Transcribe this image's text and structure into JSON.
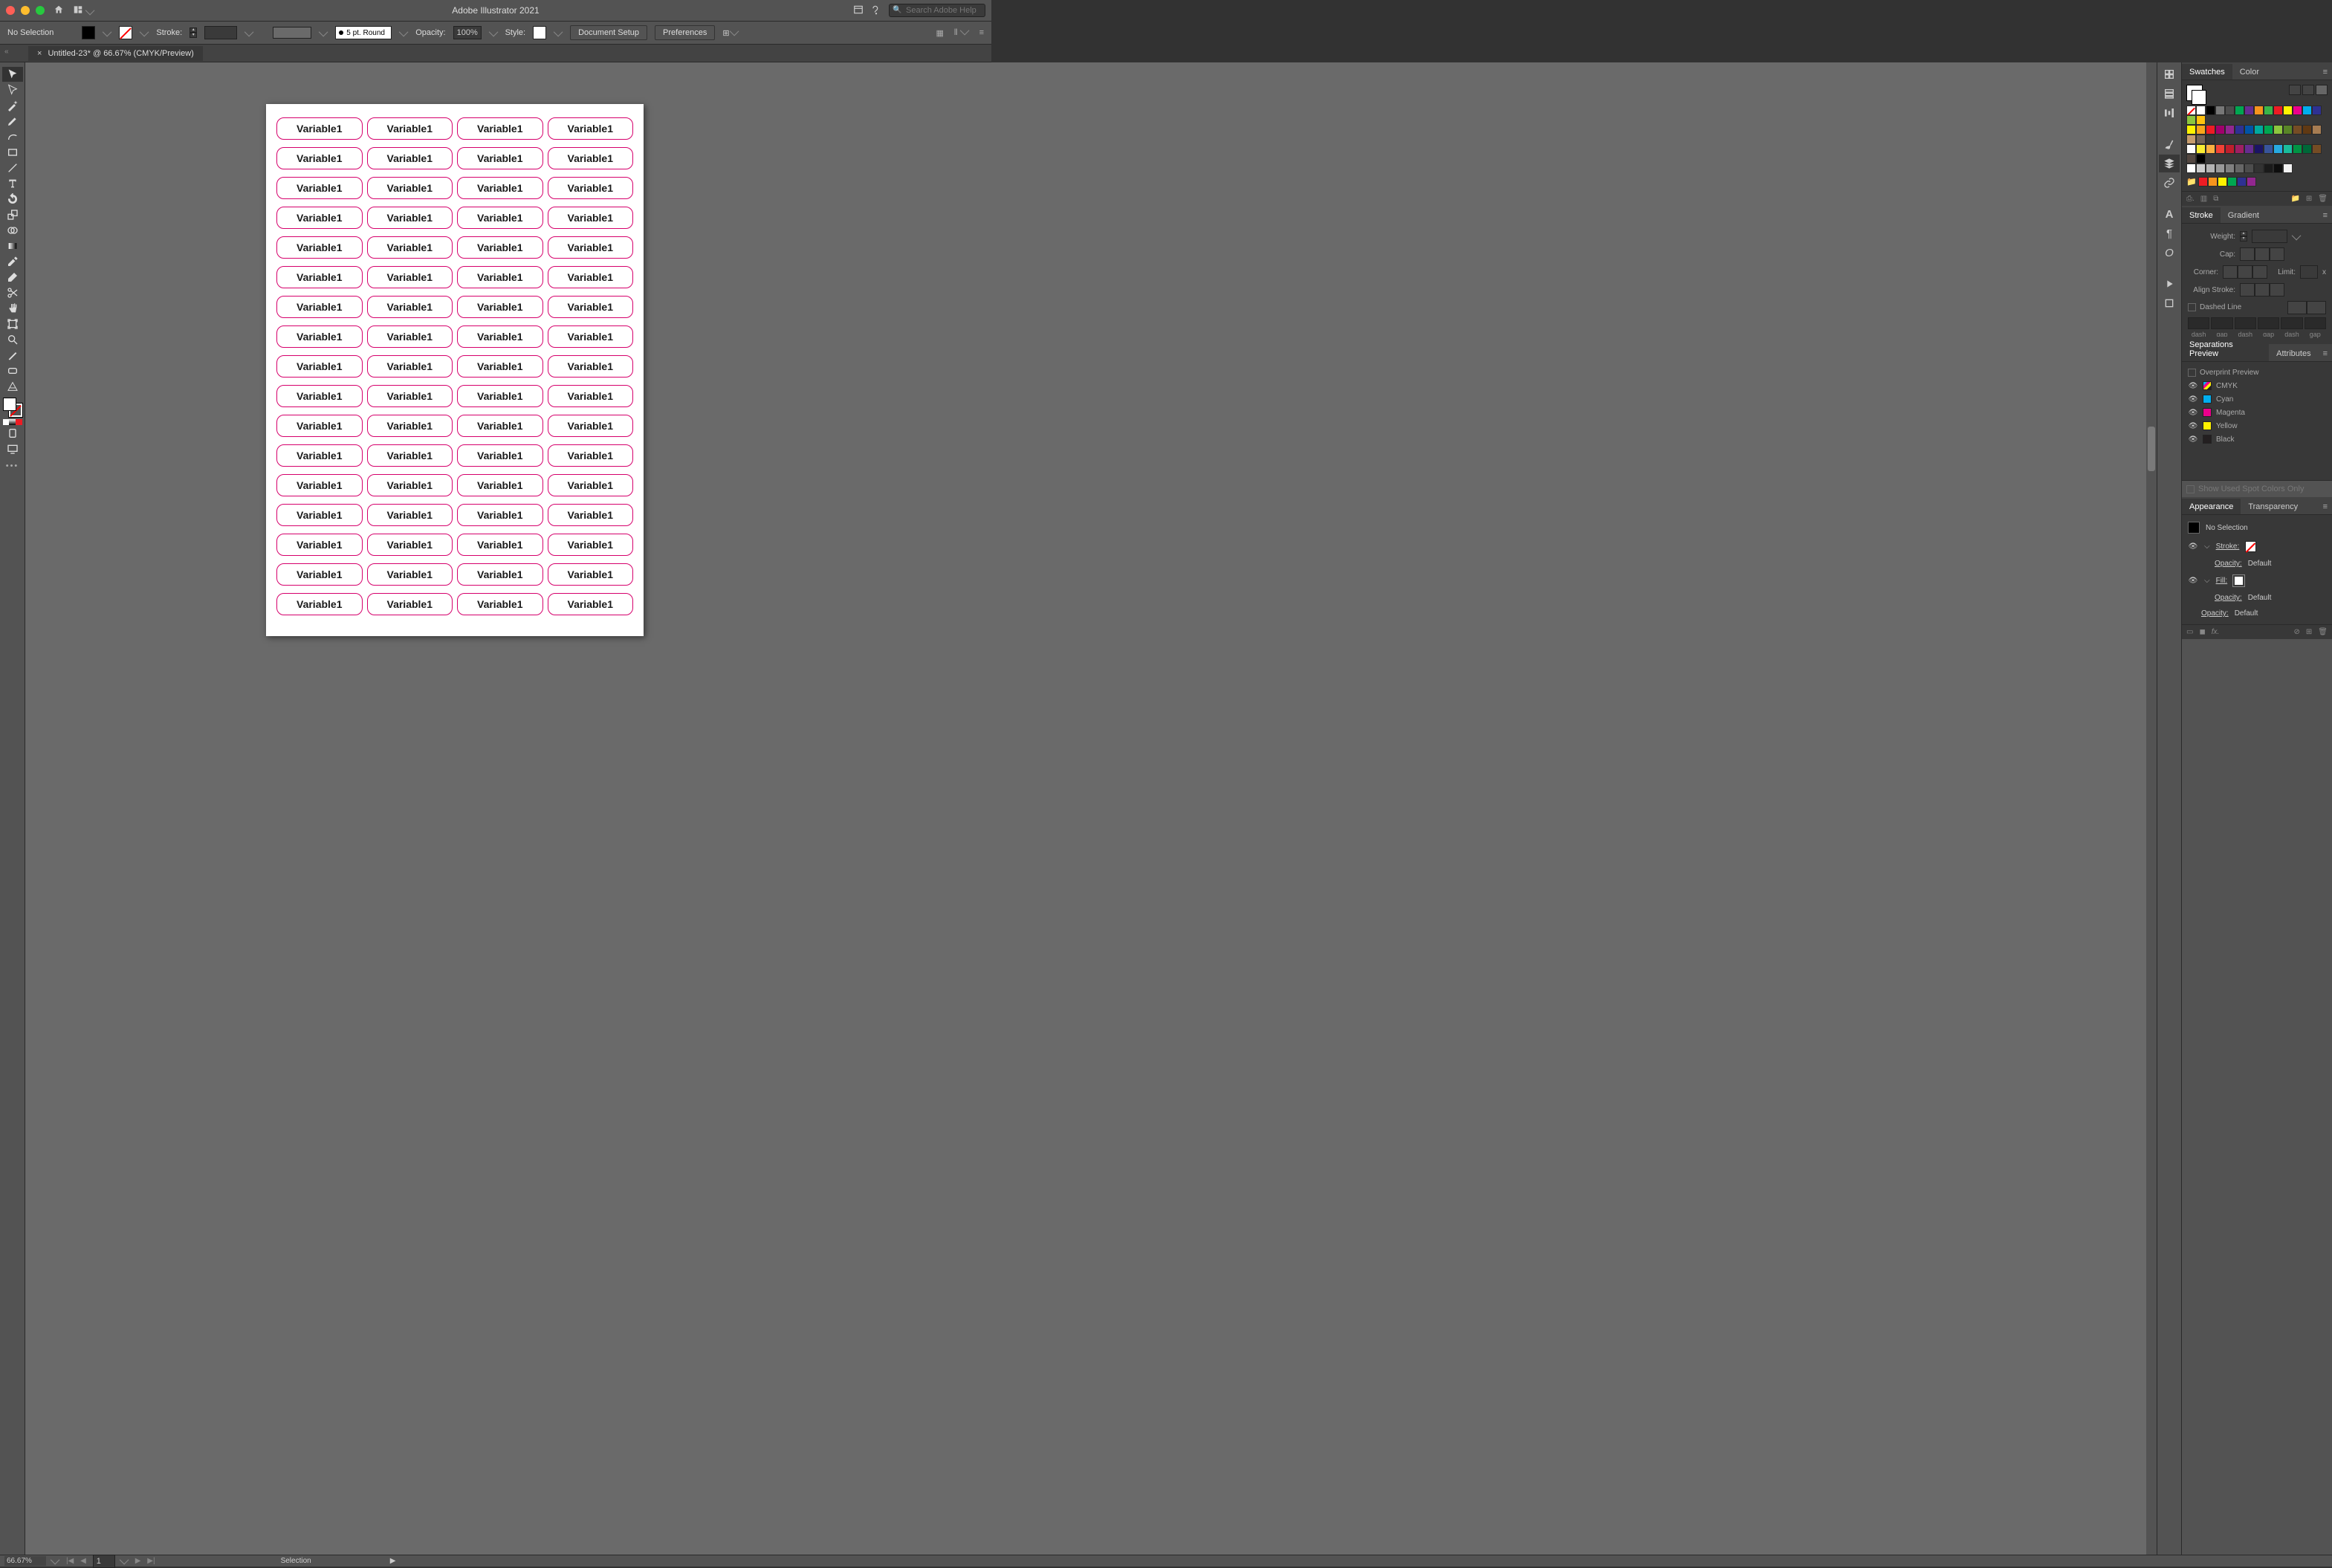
{
  "titlebar": {
    "app_title": "Adobe Illustrator 2021",
    "search_placeholder": "Search Adobe Help"
  },
  "controlbar": {
    "selection_label": "No Selection",
    "stroke_label": "Stroke:",
    "brush_label": "5 pt. Round",
    "opacity_label": "Opacity:",
    "opacity_value": "100%",
    "style_label": "Style:",
    "btn_doc_setup": "Document Setup",
    "btn_prefs": "Preferences"
  },
  "doc_tab": {
    "title": "Untitled-23* @ 66.67% (CMYK/Preview)"
  },
  "artboard": {
    "rows": 17,
    "cols": 4,
    "cell_text": "Variable1"
  },
  "panels": {
    "swatches": {
      "tab1": "Swatches",
      "tab2": "Color"
    },
    "swatch_colors": [
      [
        "none",
        "#ffffff",
        "#000000",
        "#777777",
        "#4d4d4d",
        "#00a651",
        "#662d91",
        "#f7941d",
        "#39b54a",
        "#ed1c24",
        "#fff200",
        "#ec008c",
        "#00aeef",
        "#2e3192",
        "#8dc63e",
        "#ffc20e"
      ],
      [
        "#fff200",
        "#faa61a",
        "#ed1c24",
        "#a1006b",
        "#92278f",
        "#2e3192",
        "#0054a6",
        "#00a99d",
        "#00a651",
        "#8dc63e",
        "#598527",
        "#754c24",
        "#603913",
        "#a67c52",
        "#c69c6d",
        "#736357",
        "#363636"
      ],
      [
        "#fefefe",
        "#f9ed32",
        "#fbb040",
        "#ef4136",
        "#be1e2d",
        "#9e1f63",
        "#652d90",
        "#1b1464",
        "#38559b",
        "#27aae1",
        "#1abc9c",
        "#009444",
        "#006838",
        "#754c24",
        "#534741",
        "#000000"
      ],
      [
        "#ffffff",
        "#cccccc",
        "#b3b3b3",
        "#999999",
        "#808080",
        "#666666",
        "#4d4d4d",
        "#333333",
        "#1a1a1a",
        "#0d0d0d",
        "#f2f2f2"
      ]
    ],
    "group_colors": [
      "#ed1c24",
      "#f7941d",
      "#fff200",
      "#00a651",
      "#2e3192",
      "#92278f"
    ],
    "stroke": {
      "tab1": "Stroke",
      "tab2": "Gradient",
      "weight": "Weight:",
      "cap": "Cap:",
      "corner": "Corner:",
      "limit": "Limit:",
      "limit_x": "x",
      "align": "Align Stroke:",
      "dashed": "Dashed Line",
      "dash_labels": [
        "dash",
        "gap",
        "dash",
        "gap",
        "dash",
        "gap"
      ]
    },
    "separations": {
      "tab1": "Separations Preview",
      "tab2": "Attributes",
      "overprint": "Overprint Preview",
      "inks": [
        {
          "name": "CMYK",
          "color": "linear-gradient(135deg,#00aeef 0 25%,#ec008c 25% 50%,#fff200 50% 75%,#231f20 75% 100%)"
        },
        {
          "name": "Cyan",
          "color": "#00aeef"
        },
        {
          "name": "Magenta",
          "color": "#ec008c"
        },
        {
          "name": "Yellow",
          "color": "#fff200"
        },
        {
          "name": "Black",
          "color": "#231f20"
        }
      ],
      "show_used": "Show Used Spot Colors Only"
    },
    "appearance": {
      "tab1": "Appearance",
      "tab2": "Transparency",
      "no_selection": "No Selection",
      "stroke": "Stroke:",
      "fill": "Fill:",
      "opacity": "Opacity:",
      "default": "Default"
    }
  },
  "statusbar": {
    "zoom": "66.67%",
    "page": "1",
    "tool": "Selection"
  }
}
